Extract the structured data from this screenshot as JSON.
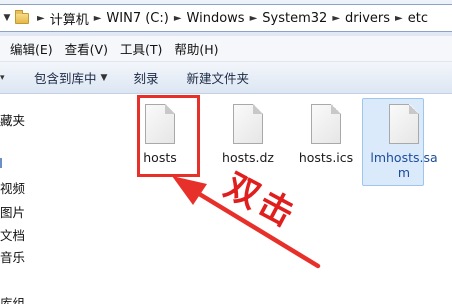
{
  "address_bar": {
    "crumbs": [
      "计算机",
      "WIN7 (C:)",
      "Windows",
      "System32",
      "drivers",
      "etc"
    ]
  },
  "menu": {
    "items": [
      "编辑(E)",
      "查看(V)",
      "工具(T)",
      "帮助(H)"
    ]
  },
  "commands": {
    "include_in_library": "包含到库中",
    "burn": "刻录",
    "new_folder": "新建文件夹"
  },
  "nav": {
    "items": [
      "藏夹",
      "视频",
      "图片",
      "文档",
      "音乐",
      "库组"
    ]
  },
  "files": [
    {
      "name": "hosts",
      "selected": false
    },
    {
      "name": "hosts.dz",
      "selected": false
    },
    {
      "name": "hosts.ics",
      "selected": false
    },
    {
      "name": "lmhosts.sam",
      "selected": true
    }
  ],
  "annotation": {
    "text": "双击",
    "color": "#e8302a"
  }
}
